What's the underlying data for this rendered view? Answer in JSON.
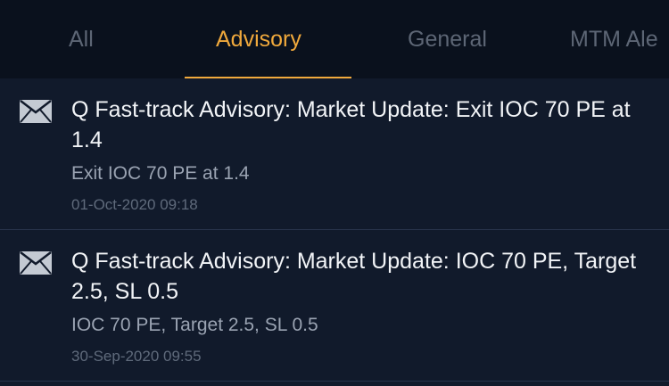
{
  "tabs": [
    {
      "label": "All",
      "active": false
    },
    {
      "label": "Advisory",
      "active": true
    },
    {
      "label": "General",
      "active": false
    },
    {
      "label": "MTM Ale",
      "active": false
    }
  ],
  "colors": {
    "accent": "#f0a93c",
    "background": "#111a2b",
    "tabbar_background": "#0a111d",
    "inactive_tab": "#5d6675"
  },
  "messages": [
    {
      "icon": "envelope-icon",
      "title": "Q Fast-track Advisory: Market Update: Exit IOC 70 PE at 1.4",
      "snippet": "Exit IOC 70 PE at 1.4",
      "timestamp": "01-Oct-2020 09:18"
    },
    {
      "icon": "envelope-icon",
      "title": "Q Fast-track Advisory: Market Update: IOC 70 PE, Target 2.5, SL 0.5",
      "snippet": "IOC 70 PE, Target 2.5, SL 0.5",
      "timestamp": "30-Sep-2020 09:55"
    }
  ]
}
